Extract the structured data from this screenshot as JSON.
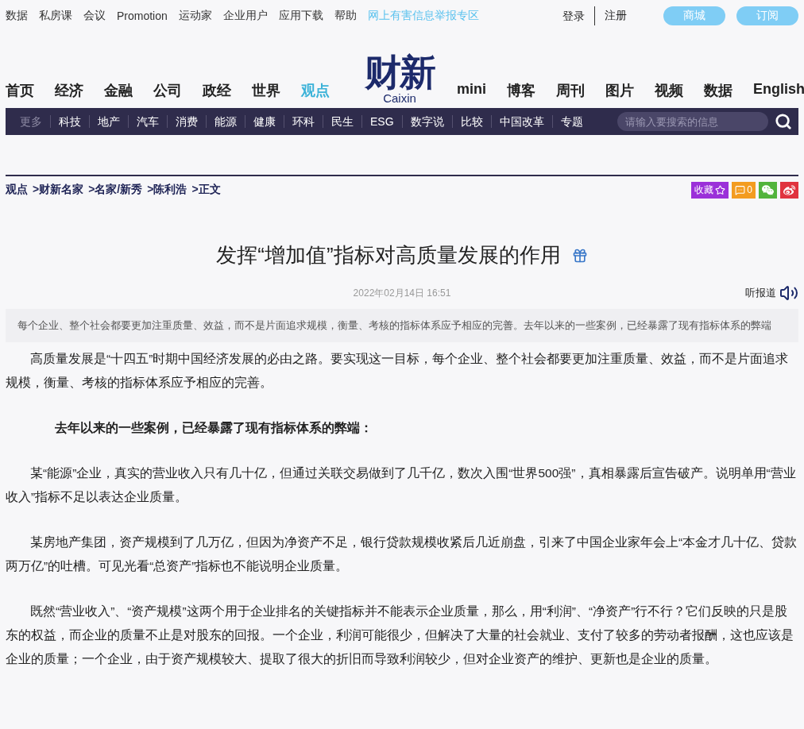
{
  "top_links": [
    {
      "label": "数据",
      "kind": "link"
    },
    {
      "label": "私房课",
      "kind": "link"
    },
    {
      "label": "会议",
      "kind": "link"
    },
    {
      "label": "Promotion",
      "kind": "link"
    },
    {
      "label": "运动家",
      "kind": "link"
    },
    {
      "label": "企业用户",
      "kind": "link"
    },
    {
      "label": "应用下载",
      "kind": "link"
    },
    {
      "label": "帮助",
      "kind": "link"
    },
    {
      "label": "网上有害信息举报专区",
      "kind": "report"
    }
  ],
  "account": {
    "login": "登录",
    "register": "注册",
    "buttons": [
      "商城",
      "订阅"
    ]
  },
  "logo": {
    "mark": "财新",
    "name": "Caixin"
  },
  "nav": {
    "left": [
      {
        "label": "首页",
        "selected": false
      },
      {
        "label": "经济",
        "selected": false
      },
      {
        "label": "金融",
        "selected": false
      },
      {
        "label": "公司",
        "selected": false
      },
      {
        "label": "政经",
        "selected": false
      },
      {
        "label": "世界",
        "selected": false
      },
      {
        "label": "观点",
        "selected": true
      }
    ],
    "right": [
      {
        "label": "mini",
        "selected": false
      },
      {
        "label": "博客",
        "selected": false
      },
      {
        "label": "周刊",
        "selected": false
      },
      {
        "label": "图片",
        "selected": false
      },
      {
        "label": "视频",
        "selected": false
      },
      {
        "label": "数据",
        "selected": false
      },
      {
        "label": "English",
        "selected": false
      }
    ]
  },
  "subnav": {
    "items": [
      {
        "label": "更多",
        "kind": "more"
      },
      {
        "label": "科技",
        "kind": "link"
      },
      {
        "label": "地产",
        "kind": "link"
      },
      {
        "label": "汽车",
        "kind": "link"
      },
      {
        "label": "消费",
        "kind": "link"
      },
      {
        "label": "能源",
        "kind": "link"
      },
      {
        "label": "健康",
        "kind": "link"
      },
      {
        "label": "环科",
        "kind": "link"
      },
      {
        "label": "民生",
        "kind": "link"
      },
      {
        "label": "ESG",
        "kind": "link"
      },
      {
        "label": "数字说",
        "kind": "link"
      },
      {
        "label": "比较",
        "kind": "link"
      },
      {
        "label": "中国改革",
        "kind": "link"
      },
      {
        "label": "专题",
        "kind": "link"
      }
    ],
    "search": {
      "placeholder": "请输入要搜索的信息"
    }
  },
  "breadcrumb": [
    "观点",
    ">财新名家",
    ">名家/新秀",
    ">陈利浩",
    ">正文"
  ],
  "share_buttons": [
    {
      "kind": "favorite",
      "label": "收藏",
      "color": "#9b30d9"
    },
    {
      "kind": "comment",
      "label": "0",
      "color": "#f39c1f"
    },
    {
      "kind": "wechat",
      "color": "#52b43c"
    },
    {
      "kind": "weibo",
      "color": "#e0333e"
    }
  ],
  "article": {
    "title": "发挥“增加值”指标对高质量发展的作用",
    "date": "2022年02月14日 16:51",
    "listen": "听报道",
    "summary": "每个企业、整个社会都要更加注重质量、效益，而不是片面追求规模，衡量、考核的指标体系应予相应的完善。去年以来的一些案例，已经暴露了现有指标体系的弊端",
    "paragraphs": [
      {
        "kind": "body",
        "text": "高质量发展是“十四五”时期中国经济发展的必由之路。要实现这一目标，每个企业、整个社会都要更加注重质量、效益，而不是片面追求规模，衡量、考核的指标体系应予相应的完善。"
      },
      {
        "kind": "heading",
        "text": "去年以来的一些案例，已经暴露了现有指标体系的弊端："
      },
      {
        "kind": "body",
        "text": "某“能源”企业，真实的营业收入只有几十亿，但通过关联交易做到了几千亿，数次入围“世界500强”，真相暴露后宣告破产。说明单用“营业收入”指标不足以表达企业质量。"
      },
      {
        "kind": "body",
        "text": "某房地产集团，资产规模到了几万亿，但因为净资产不足，银行贷款规模收紧后几近崩盘，引来了中国企业家年会上“本金才几十亿、贷款两万亿”的吐槽。可见光看“总资产”指标也不能说明企业质量。"
      },
      {
        "kind": "body",
        "text": "既然“营业收入”、“资产规模”这两个用于企业排名的关键指标并不能表示企业质量，那么，用“利润”、“净资产”行不行？它们反映的只是股东的权益，而企业的质量不止是对股东的回报。一个企业，利润可能很少，但解决了大量的社会就业、支付了较多的劳动者报酬，这也应该是企业的质量；一个企业，由于资产规模较大、提取了很大的折旧而导致利润较少，但对企业资产的维护、更新也是企业的质量。"
      }
    ]
  }
}
